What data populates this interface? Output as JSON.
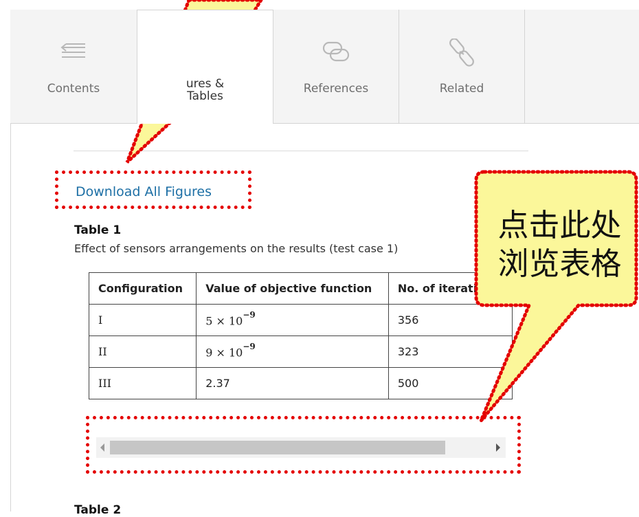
{
  "tabs": [
    {
      "label": "Contents",
      "icon": "list-icon"
    },
    {
      "label": "ures & Tables",
      "line1": "ures &",
      "line2": "Tables",
      "icon": "figures-icon"
    },
    {
      "label": "References",
      "icon": "references-icon"
    },
    {
      "label": "Related",
      "icon": "related-link-icon"
    }
  ],
  "download_link": "Download All Figures",
  "table1": {
    "title": "Table 1",
    "caption": "Effect of sensors arrangements on the results (test case 1)",
    "headers": [
      "Configuration",
      "Value of objective function",
      "No. of iterations"
    ],
    "rows": [
      {
        "config": "I",
        "value_base": "5 × 10",
        "value_exp": "−9",
        "iterations": "356"
      },
      {
        "config": "II",
        "value_base": "9 × 10",
        "value_exp": "−9",
        "iterations": "323"
      },
      {
        "config": "III",
        "value": "2.37",
        "iterations": "500"
      }
    ]
  },
  "table2_title": "Table 2",
  "callout": {
    "line1": "点击此处",
    "line2": "浏览表格"
  },
  "colors": {
    "link": "#1d6fa5",
    "annotation": "#e40000",
    "callout_fill": "#fbf79a"
  }
}
